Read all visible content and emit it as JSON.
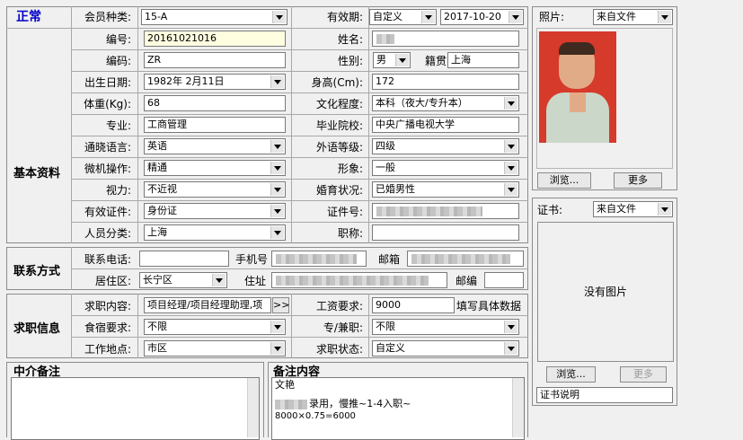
{
  "status": "正常",
  "sections": {
    "basic": "基本资料",
    "contact": "联系方式",
    "job": "求职信息",
    "agency_note": "中介备注",
    "remark": "备注内容"
  },
  "top": {
    "member_type_label": "会员种类:",
    "member_type_value": "15-A",
    "validity_label": "有效期:",
    "validity_mode": "自定义",
    "validity_date": "2017-10-20"
  },
  "basic": {
    "no_label": "编号:",
    "no_value": "20161021016",
    "name_label": "姓名:",
    "code_label": "编码:",
    "code_value": "ZR",
    "gender_label": "性别:",
    "gender_value": "男",
    "native_label": "籍贯",
    "native_value": "上海",
    "birth_label": "出生日期:",
    "birth_value": "1982年 2月11日",
    "height_label": "身高(Cm):",
    "height_value": "172",
    "weight_label": "体重(Kg):",
    "weight_value": "68",
    "edu_label": "文化程度:",
    "edu_value": "本科（夜大/专升本）",
    "major_label": "专业:",
    "major_value": "工商管理",
    "school_label": "毕业院校:",
    "school_value": "中央广播电视大学",
    "lang_label": "通晓语言:",
    "lang_value": "英语",
    "lang_level_label": "外语等级:",
    "lang_level_value": "四级",
    "computer_label": "微机操作:",
    "computer_value": "精通",
    "image_label": "形象:",
    "image_value": "一般",
    "vision_label": "视力:",
    "vision_value": "不近视",
    "marital_label": "婚育状况:",
    "marital_value": "已婚男性",
    "id_type_label": "有效证件:",
    "id_type_value": "身份证",
    "id_no_label": "证件号:",
    "category_label": "人员分类:",
    "category_value": "上海",
    "title_label": "职称:"
  },
  "contact": {
    "phone_label": "联系电话:",
    "mobile_label": "手机号",
    "email_label": "邮箱",
    "district_label": "居住区:",
    "district_value": "长宁区",
    "address_label": "住址",
    "postcode_label": "邮编"
  },
  "job": {
    "want_label": "求职内容:",
    "want_value": "项目经理/项目经理助理,项",
    "more_btn": ">>",
    "salary_label": "工资要求:",
    "salary_value": "9000",
    "salary_hint": "填写具体数据",
    "board_label": "食宿要求:",
    "board_value": "不限",
    "parttime_label": "专/兼职:",
    "parttime_value": "不限",
    "location_label": "工作地点:",
    "location_value": "市区",
    "job_status_label": "求职状态:",
    "job_status_value": "自定义"
  },
  "remark": {
    "line1": "文艳",
    "line2": "录用，慢推~1-4入职~",
    "line3": "8000×0.75=6000"
  },
  "photo": {
    "label": "照片:",
    "source": "来自文件",
    "browse": "浏览...",
    "more": "更多"
  },
  "cert": {
    "label": "证书:",
    "source": "来自文件",
    "no_image": "没有图片",
    "browse": "浏览...",
    "more": "更多",
    "desc": "证书说明"
  }
}
